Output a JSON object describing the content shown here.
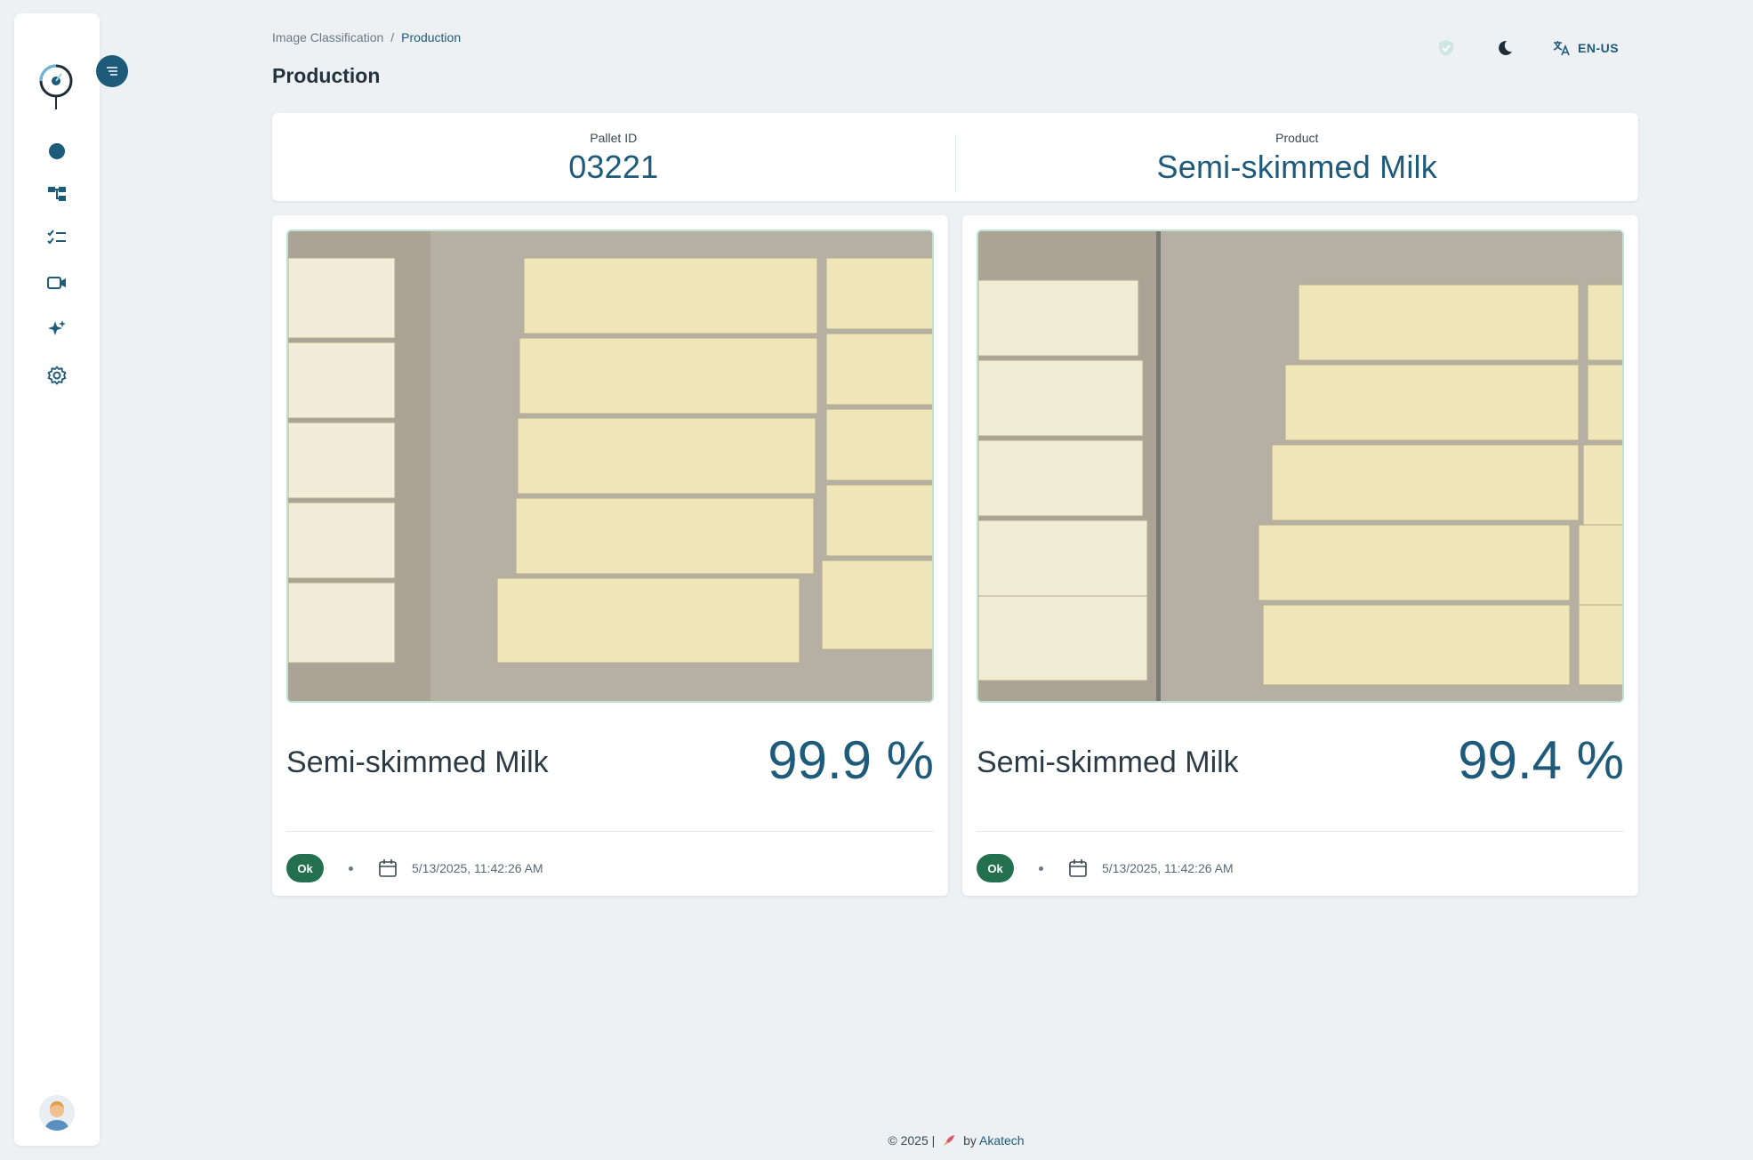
{
  "sidebar": {
    "items": [
      {
        "icon": "dashboard-dot-icon"
      },
      {
        "icon": "hierarchy-icon"
      },
      {
        "icon": "checklist-icon"
      },
      {
        "icon": "video-camera-icon"
      },
      {
        "icon": "sparkles-icon"
      },
      {
        "icon": "gear-icon"
      }
    ]
  },
  "header": {
    "breadcrumb": [
      "Image Classification",
      "/",
      "Production"
    ],
    "title": "Production",
    "language": "EN-US"
  },
  "info": {
    "pallet_label": "Pallet ID",
    "pallet_value": "03221",
    "product_label": "Product",
    "product_value": "Semi-skimmed Milk"
  },
  "results": [
    {
      "name": "Semi-skimmed Milk",
      "score": "99.9 %",
      "status": "Ok",
      "date": "5/13/2025, 11:42:26 AM"
    },
    {
      "name": "Semi-skimmed Milk",
      "score": "99.4 %",
      "status": "Ok",
      "date": "5/13/2025, 11:42:26 AM"
    }
  ],
  "footer": {
    "copyright": "© 2025 |",
    "by": "by",
    "brand": "Akatech"
  },
  "colors": {
    "accent": "#1e5a7a",
    "status_ok": "#23704e",
    "background": "#eef1f4"
  }
}
